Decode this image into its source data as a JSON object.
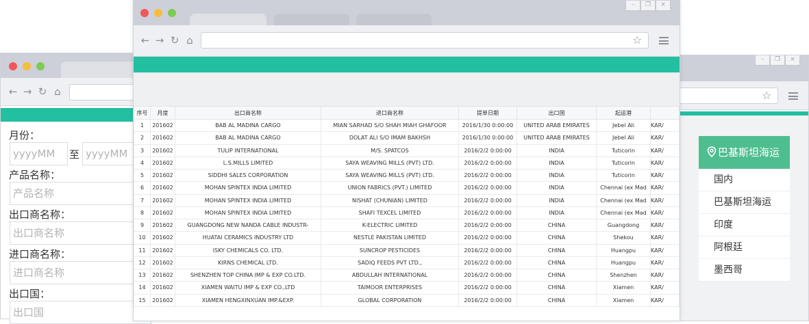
{
  "left_window": {
    "form": {
      "month_label": "月份：",
      "month_from_placeholder": "yyyyMM",
      "month_sep": "至",
      "month_to_placeholder": "yyyyMM",
      "product_label": "产品名称：",
      "product_placeholder": "产品名称",
      "exporter_label": "出口商名称：",
      "exporter_placeholder": "出口商名称",
      "importer_label": "进口商名称：",
      "importer_placeholder": "进口商名称",
      "country_label": "出口国：",
      "country_placeholder": "出口国"
    }
  },
  "right_window": {
    "side_menu": {
      "header": "巴基斯坦海运",
      "header_icon": "location-pin-icon",
      "items": [
        "国内",
        "巴基斯坦海运",
        "印度",
        "阿根廷",
        "墨西哥"
      ]
    }
  },
  "main_window": {
    "accent_color": "#22bfa0",
    "table": {
      "columns": [
        "序号",
        "月度",
        "出口商名称",
        "进口商名称",
        "提单日期",
        "出口国",
        "起运港",
        ""
      ],
      "rows": [
        [
          "1",
          "201602",
          "BAB AL MADINA CARGO",
          "MIAN SARHAD S/O SHAH MIAH GHAFOOR",
          "2016/1/30 0:00:00",
          "UNITED ARAB EMIRATES",
          "Jebel Ali",
          "KAR/"
        ],
        [
          "2",
          "201602",
          "BAB AL MADINA CARGO",
          "DOLAT ALI S/O IMAM BAKHSH",
          "2016/1/30 0:00:00",
          "UNITED ARAB EMIRATES",
          "Jebel Ali",
          "KAR/"
        ],
        [
          "3",
          "201602",
          "TULIP INTERNATIONAL",
          "M/S. SPATCOS",
          "2016/2/2 0:00:00",
          "INDIA",
          "Tuticorin",
          "KAR/"
        ],
        [
          "4",
          "201602",
          "L.S.MILLS LIMITED",
          "SAYA WEAVING MILLS (PVT) LTD.",
          "2016/2/2 0:00:00",
          "INDIA",
          "Tuticorin",
          "KAR/"
        ],
        [
          "5",
          "201602",
          "SIDDHI SALES CORPORATION",
          "SAYA WEAVING MILLS (PVT) LTD.",
          "2016/2/2 0:00:00",
          "INDIA",
          "Tuticorin",
          "KAR/"
        ],
        [
          "6",
          "201602",
          "MOHAN SPINTEX INDIA LIMITED",
          "UNION FABRICS (PVT.) LIMITED",
          "2016/2/2 0:00:00",
          "INDIA",
          "Chennai (ex Mad",
          "KAR/"
        ],
        [
          "7",
          "201602",
          "MOHAN SPINTEX INDIA LIMITED",
          "NISHAT (CHUNIAN) LIMITED",
          "2016/2/2 0:00:00",
          "INDIA",
          "Chennai (ex Mad",
          "KAR/"
        ],
        [
          "8",
          "201602",
          "MOHAN SPINTEX INDIA LIMITED",
          "SHAFI TEXCEL LIMITED",
          "2016/2/2 0:00:00",
          "INDIA",
          "Chennai (ex Mad",
          "KAR/"
        ],
        [
          "9",
          "201602",
          "GUANGDONG NEW NANDA CABLE INDUSTR-",
          "K-ELECTRIC LIMITED",
          "2016/2/2 0:00:00",
          "CHINA",
          "Guangdong",
          "KAR/"
        ],
        [
          "10",
          "201602",
          "HUATAI CERAMICS INDUSTRY LTD",
          "NESTLE PAKISTAN LIMITED",
          "2016/2/2 0:00:00",
          "CHINA",
          "Shekou",
          "KAR/"
        ],
        [
          "11",
          "201602",
          "ISKY CHEMICALS CO. LTD.",
          "SUNCROP PESTICIDES",
          "2016/2/2 0:00:00",
          "CHINA",
          "Huangpu",
          "KAR/"
        ],
        [
          "12",
          "201602",
          "KIRNS CHEMICAL LTD.",
          "SADIQ FEEDS PVT LTD.,",
          "2016/2/2 0:00:00",
          "CHINA",
          "Huangpu",
          "KAR/"
        ],
        [
          "13",
          "201602",
          "SHENZHEN TOP CHINA IMP & EXP CO.LTD.",
          "ABDULLAH INTERNATIONAL",
          "2016/2/2 0:00:00",
          "CHINA",
          "Shenzhen",
          "KAR/"
        ],
        [
          "14",
          "201602",
          "XIAMEN WAITU IMP & EXP CO.,LTD",
          "TAIMOOR ENTERPRISES",
          "2016/2/2 0:00:00",
          "CHINA",
          "Xiamen",
          "KAR/"
        ],
        [
          "15",
          "201602",
          "XIAMEN HENGXINXUAN IMP.&EXP.",
          "GLOBAL CORPORATION",
          "2016/2/2 0:00:00",
          "CHINA",
          "Xiamen",
          "KAR/"
        ]
      ]
    }
  }
}
